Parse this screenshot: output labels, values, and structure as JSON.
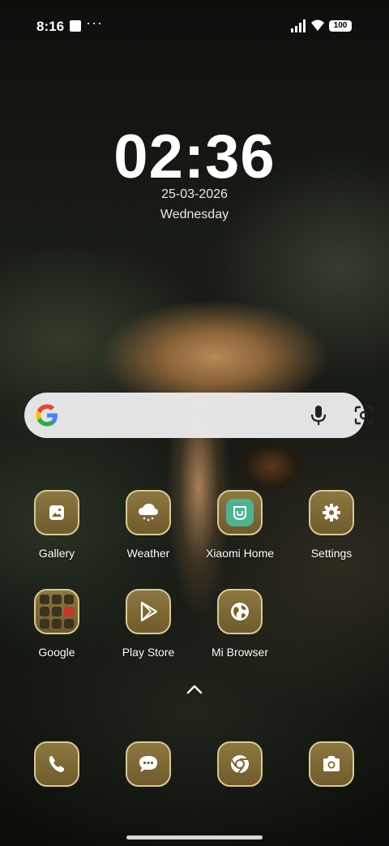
{
  "status_bar": {
    "time": "8:16",
    "battery": "100",
    "icons": [
      "notification-square-icon",
      "more-dots-icon",
      "signal-icon",
      "wifi-icon",
      "battery-icon"
    ]
  },
  "clock": {
    "time": "02:36",
    "date": "25-03-2026",
    "day": "Wednesday"
  },
  "search_bar": {
    "icons": [
      "google-logo-icon",
      "microphone-icon",
      "lens-camera-icon"
    ]
  },
  "apps_row1": [
    {
      "label": "Gallery",
      "icon": "gallery-icon"
    },
    {
      "label": "Weather",
      "icon": "weather-cloud-icon"
    },
    {
      "label": "Xiaomi Home",
      "icon": "xiaomi-home-icon"
    },
    {
      "label": "Settings",
      "icon": "gear-icon"
    }
  ],
  "apps_row2": [
    {
      "label": "Google",
      "icon": "folder-icon"
    },
    {
      "label": "Play Store",
      "icon": "play-store-icon"
    },
    {
      "label": "Mi Browser",
      "icon": "globe-icon"
    }
  ],
  "dock": [
    {
      "icon": "phone-icon"
    },
    {
      "icon": "messages-icon"
    },
    {
      "icon": "chrome-icon"
    },
    {
      "icon": "camera-icon"
    }
  ],
  "colors": {
    "tile_gold": "#8d7741",
    "tile_border": "#d7c99a",
    "xiaomi_green": "#4db38f",
    "search_bg": "#f2f2f2"
  }
}
